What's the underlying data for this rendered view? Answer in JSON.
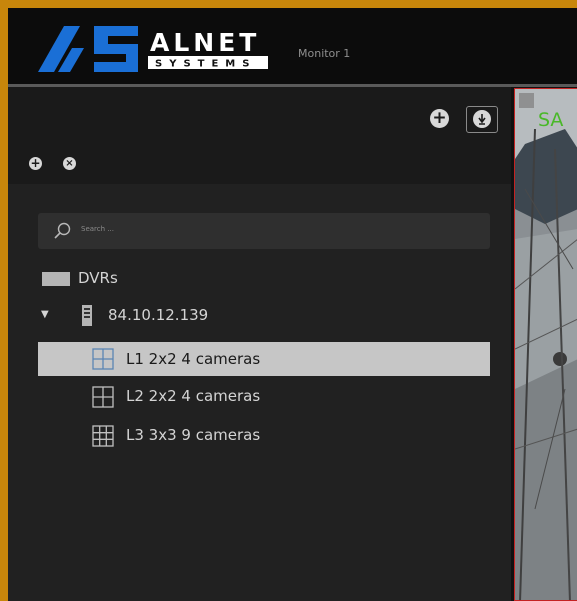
{
  "header": {
    "logo_mark": "AS",
    "logo_word": "ALNET",
    "logo_sub": "SYSTEMS",
    "monitor_title": "Monitor 1"
  },
  "panel": {
    "search_placeholder": "Search ...",
    "tree": {
      "root_label": "DVRs",
      "server_label": "84.10.12.139",
      "layouts": [
        {
          "label": "L1 2x2 4 cameras",
          "selected": true
        },
        {
          "label": "L2 2x2 4 cameras",
          "selected": false
        },
        {
          "label": "L3 3x3 9 cameras",
          "selected": false
        }
      ]
    }
  },
  "feed": {
    "camera_name": "SA"
  },
  "colors": {
    "frame": "#c8860b",
    "logo_blue": "#1a6fd6",
    "camera_name": "#49b828",
    "feed_border": "#c42222",
    "selection": "#c6c6c6"
  },
  "icons": [
    "add-icon",
    "pin-icon",
    "close-icon",
    "search-icon",
    "folder-icon",
    "caret-down-icon",
    "computer-icon",
    "grid-2x2-icon",
    "grid-3x3-icon",
    "move-icon"
  ]
}
